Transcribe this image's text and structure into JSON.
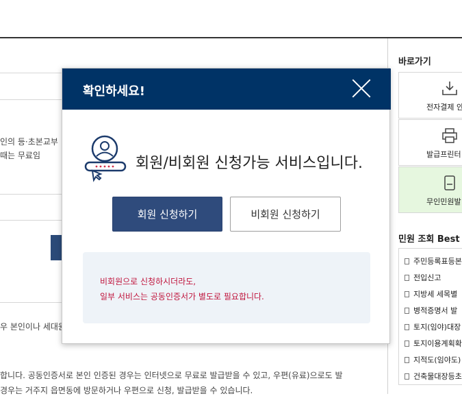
{
  "background": {
    "texts": [
      "인의 등·초본교부",
      "때는 무료임",
      "우 본인이나 세대원",
      "합니다. 공동인증서로 본인 인증된 경우는 인터넷으로 무료로 발급받을 수 있고, 우편(유료)으로도 발",
      " 경우는 거주지 읍면동에 방문하거나 우편으로 신청, 발급받을 수 있습니다."
    ]
  },
  "sidebar": {
    "title": "바로가기",
    "quick_links": [
      {
        "label": "전자결제 안",
        "icon": "download-icon"
      },
      {
        "label": "발급프린터",
        "icon": "printer-icon"
      },
      {
        "label": "무인민원발",
        "icon": "kiosk-icon"
      }
    ],
    "best_title": "민원 조회 Best",
    "best_items": [
      "주민등록표등본",
      "전입신고",
      "지방세 세목별",
      "병적증명서 발",
      "토지(임야)대장",
      "토지이용계획확",
      "지적도(임야도)",
      "건축물대장등초"
    ]
  },
  "modal": {
    "title": "확인하세요!",
    "message": "회원/비회원 신청가능 서비스입니다.",
    "member_button": "회원 신청하기",
    "guest_button": "비회원 신청하기",
    "note_line1": "비회원으로 신청하시더라도,",
    "note_line2": "일부 서비스는 공동인증서가 별도로 필요합니다.",
    "colors": {
      "header": "#003366",
      "primary_button": "#2f4b7c",
      "note_text": "#c0143c",
      "note_bg": "#eef3f8"
    }
  }
}
